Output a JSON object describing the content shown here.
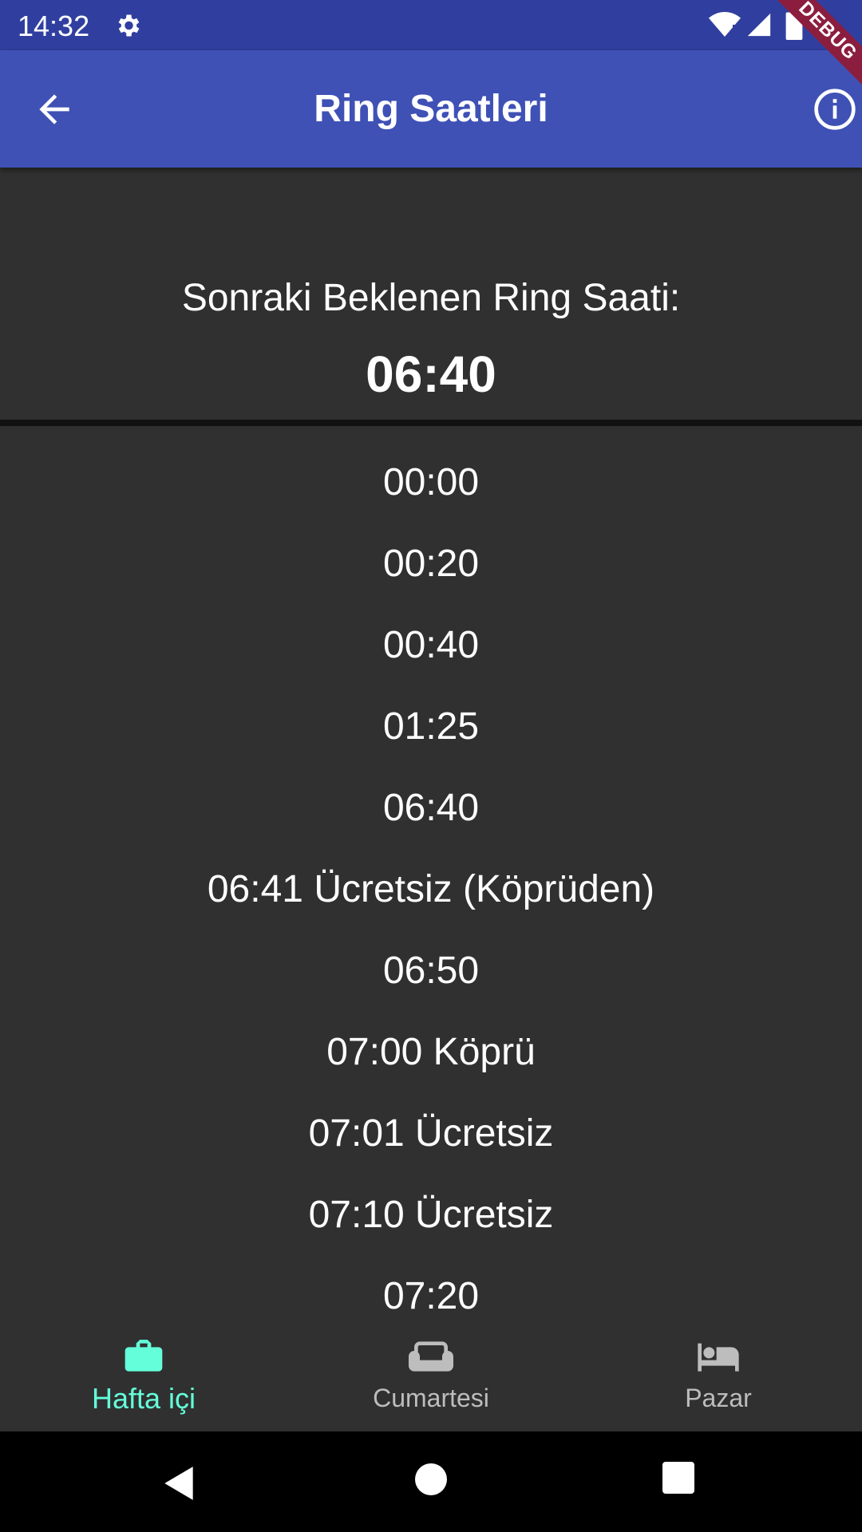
{
  "status_bar": {
    "time": "14:32",
    "icons": [
      "gear-icon",
      "wifi-icon",
      "signal-icon",
      "battery-icon"
    ]
  },
  "app_bar": {
    "title": "Ring Saatleri",
    "back_icon": "arrow-back-icon",
    "info_icon": "info-icon",
    "color": "#3F51B5"
  },
  "debug_banner": "DEBUG",
  "next_ring": {
    "label": "Sonraki Beklenen Ring Saati:",
    "time": "06:40"
  },
  "schedule": [
    "00:00",
    "00:20",
    "00:40",
    "01:25",
    "06:40",
    "06:41 Ücretsiz (Köprüden)",
    "06:50",
    "07:00 Köprü",
    "07:01 Ücretsiz",
    "07:10 Ücretsiz",
    "07:20"
  ],
  "bottom_nav": {
    "items": [
      {
        "label": "Hafta içi",
        "icon": "briefcase-icon",
        "active": true
      },
      {
        "label": "Cumartesi",
        "icon": "sofa-icon",
        "active": false
      },
      {
        "label": "Pazar",
        "icon": "bed-icon",
        "active": false
      }
    ],
    "active_color": "#64FFDA",
    "inactive_color": "#BDBDBD"
  },
  "system_nav": {
    "icons": [
      "back-triangle-icon",
      "home-circle-icon",
      "recents-square-icon"
    ]
  }
}
